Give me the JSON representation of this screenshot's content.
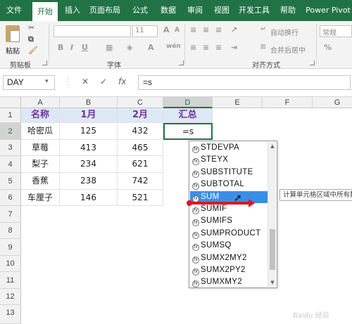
{
  "ribbon_tabs": [
    {
      "label": "文件"
    },
    {
      "label": "开始"
    },
    {
      "label": "插入"
    },
    {
      "label": "页面布局"
    },
    {
      "label": "公式"
    },
    {
      "label": "数据"
    },
    {
      "label": "审阅"
    },
    {
      "label": "视图"
    },
    {
      "label": "开发工具"
    },
    {
      "label": "帮助"
    },
    {
      "label": "Power Pivot"
    }
  ],
  "ribbon": {
    "paste_label": "粘贴",
    "clipboard_group": "剪贴板",
    "font_group": "字体",
    "alignment_group": "对齐方式",
    "font_size": "11",
    "wrap_text": "自动换行",
    "merge_center": "合并后居中",
    "number_format": "常规",
    "bold": "B",
    "italic": "I",
    "underline": "U"
  },
  "formula_bar": {
    "name_box": "DAY",
    "fx_label": "fx",
    "formula": "=s"
  },
  "columns": [
    "A",
    "B",
    "C",
    "D",
    "E",
    "F",
    "G"
  ],
  "rows": [
    "1",
    "2",
    "3",
    "4",
    "5",
    "6",
    "7",
    "8",
    "9",
    "10",
    "11",
    "12",
    "13"
  ],
  "table": {
    "headers": [
      "名称",
      "1月",
      "2月",
      "汇总"
    ],
    "rows": [
      [
        "哈密瓜",
        "125",
        "432",
        "=s"
      ],
      [
        "草莓",
        "413",
        "465",
        ""
      ],
      [
        "梨子",
        "234",
        "621",
        ""
      ],
      [
        "香蕉",
        "238",
        "742",
        ""
      ],
      [
        "车厘子",
        "146",
        "521",
        ""
      ]
    ]
  },
  "autocomplete": {
    "items": [
      "STDEVPA",
      "STEYX",
      "SUBSTITUTE",
      "SUBTOTAL",
      "SUM",
      "SUMIF",
      "SUMIFS",
      "SUMPRODUCT",
      "SUMSQ",
      "SUMX2MY2",
      "SUMX2PY2",
      "SUMXMY2"
    ],
    "selected_index": 4,
    "tooltip": "计算单元格区域中所有数"
  },
  "watermark": "Baidu 经验",
  "colors": {
    "excel_green": "#217346",
    "header_fill": "#dde8f5",
    "header_text": "#7030a0",
    "selection_blue": "#3a8ee6",
    "annotation_red": "#d9162c"
  }
}
